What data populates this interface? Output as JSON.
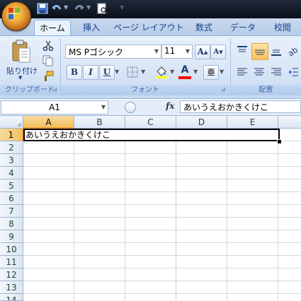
{
  "tabs": [
    "ホーム",
    "挿入",
    "ページ レイアウト",
    "数式",
    "データ",
    "校閲"
  ],
  "clipboard": {
    "paste_label": "貼り付け",
    "group_label": "クリップボード"
  },
  "font": {
    "name": "MS Pゴシック",
    "size": "11",
    "group_label": "フォント",
    "bold": "B",
    "italic": "I",
    "underline": "U",
    "grow": "A",
    "shrink": "A",
    "font_color_letter": "A",
    "phonetic_letter": "亜"
  },
  "alignment": {
    "group_label": "配置"
  },
  "formula_bar": {
    "name_box": "A1",
    "fx": "fx",
    "content": "あいうえおかきくけこ"
  },
  "sheet": {
    "columns": [
      "A",
      "B",
      "C",
      "D",
      "E"
    ],
    "rows": [
      "1",
      "2",
      "3",
      "4",
      "5",
      "6",
      "7",
      "8",
      "9",
      "10",
      "11",
      "12",
      "13",
      "14"
    ],
    "cells": {
      "A1": "あいうえおかきくけこ"
    }
  },
  "colors": {
    "accent": "#15428b",
    "selection": "#f29536",
    "highlight": "#ffff00",
    "font_color": "#ff0000"
  }
}
